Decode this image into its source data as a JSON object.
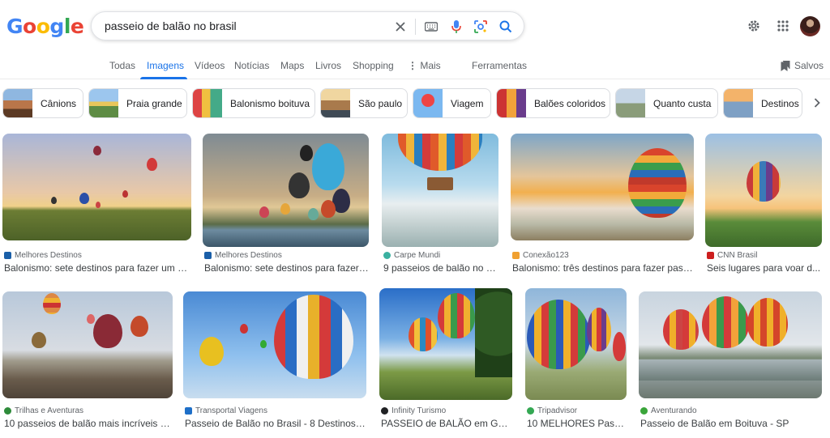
{
  "brand": {
    "logo_text": "Google",
    "logo_colors": [
      "#4285f4",
      "#ea4335",
      "#fbbc05",
      "#4285f4",
      "#34a853",
      "#ea4335"
    ]
  },
  "search": {
    "query": "passeio de balão no brasil"
  },
  "icons": {
    "clear": "close-icon",
    "keyboard": "keyboard-icon",
    "voice": "microphone-icon",
    "lens": "camera-lens-icon",
    "search": "search-icon",
    "settings": "gear-icon",
    "apps": "apps-grid-icon"
  },
  "tabs": [
    "Todas",
    "Imagens",
    "Vídeos",
    "Notícias",
    "Maps",
    "Livros",
    "Shopping",
    "Mais",
    "Ferramentas"
  ],
  "active_tab": "Imagens",
  "saved_label": "Salvos",
  "chips": [
    "Cânions",
    "Praia grande",
    "Balonismo boituva",
    "São paulo",
    "Viagem",
    "Balões coloridos",
    "Quanto custa",
    "Destinos"
  ],
  "results": [
    {
      "source": "Melhores Destinos",
      "title": "Balonismo: sete destinos para fazer um pa..."
    },
    {
      "source": "Melhores Destinos",
      "title": "Balonismo: sete destinos para fazer u..."
    },
    {
      "source": "Carpe Mundi",
      "title": "9 passeios de balão no B..."
    },
    {
      "source": "Conexão123",
      "title": "Balonismo: três destinos para fazer passe..."
    },
    {
      "source": "CNN Brasil",
      "title": "Seis lugares para voar d..."
    },
    {
      "source": "Trilhas e Aventuras",
      "title": "10 passeios de balão mais incríveis d..."
    },
    {
      "source": "Transportal Viagens",
      "title": "Passeio de Balão no Brasil - 8 Destinos In..."
    },
    {
      "source": "Infinity Turismo",
      "title": "PASSEIO de BALÃO em GR..."
    },
    {
      "source": "Tripadvisor",
      "title": "10 MELHORES Pass..."
    },
    {
      "source": "Aventurando",
      "title": "Passeio de Balão em Boituva - SP"
    }
  ],
  "colors": {
    "accent": "#1a73e8",
    "text": "#202124",
    "muted": "#5f6368"
  }
}
